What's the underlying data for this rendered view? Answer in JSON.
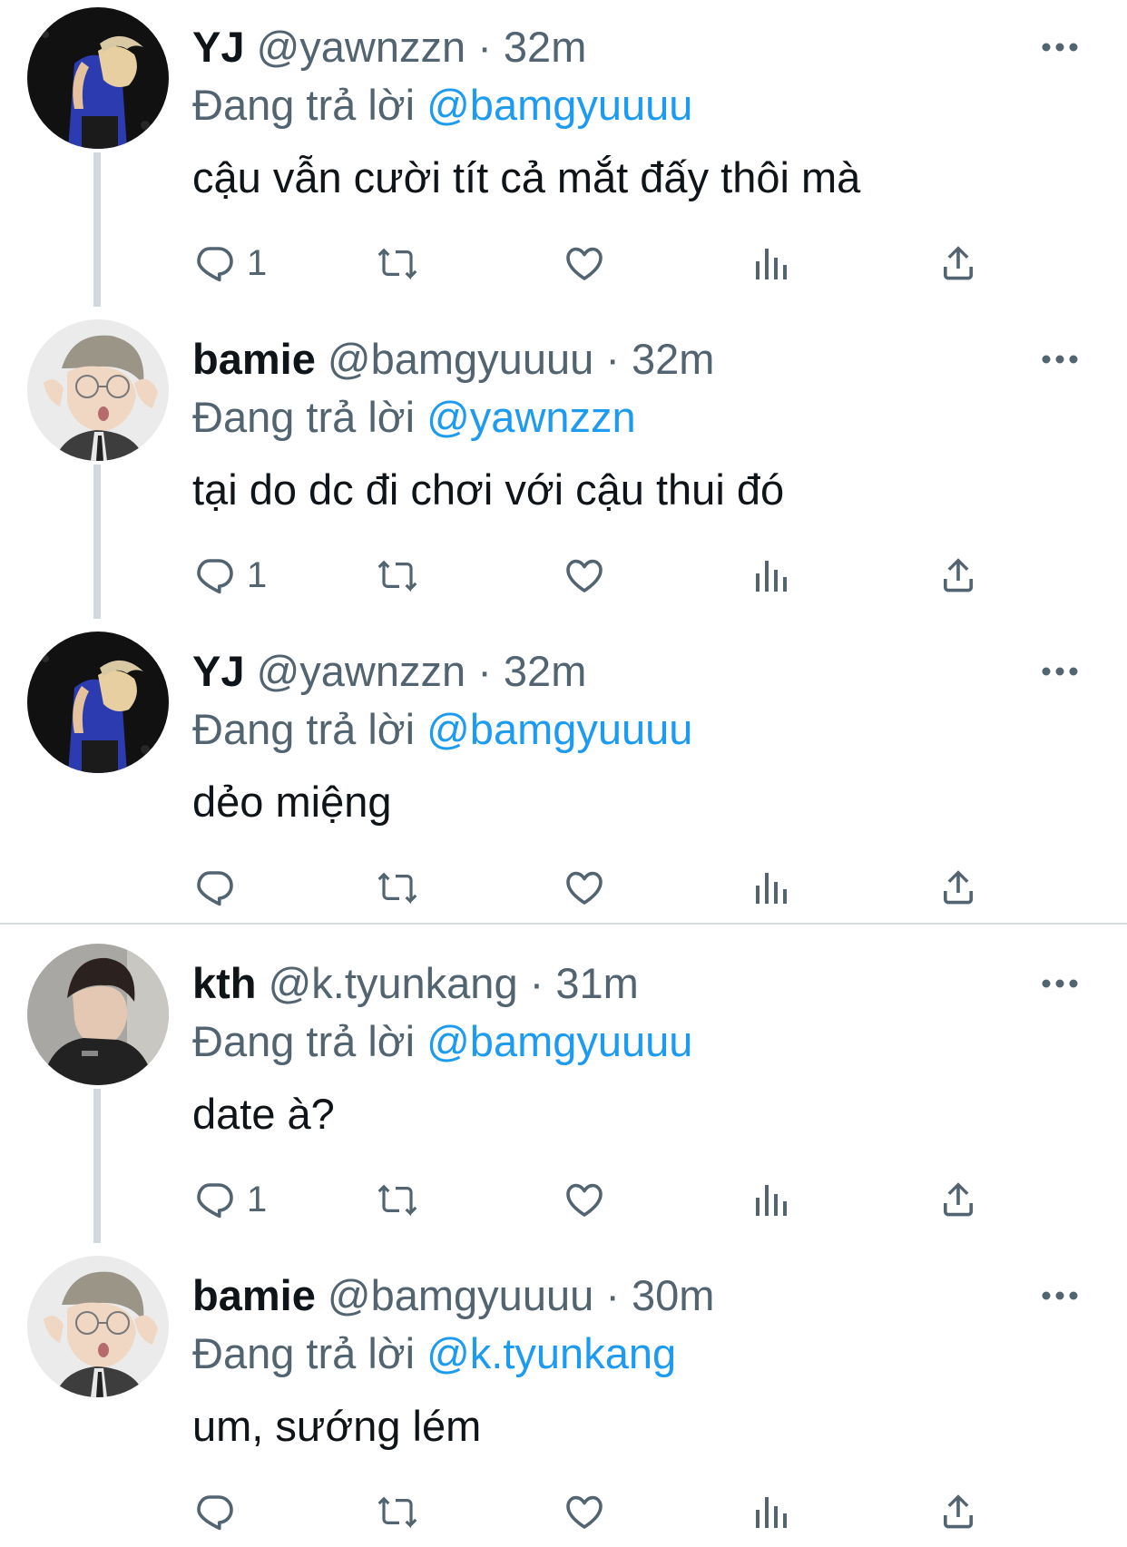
{
  "labels": {
    "replying_prefix": "Đang trả lời"
  },
  "colors": {
    "name": "#0f1419",
    "secondary": "#536471",
    "mention": "#1d9bf0",
    "thread_line": "#cfd9de"
  },
  "tweets": [
    {
      "name": "YJ",
      "handle": "@yawnzzn",
      "separator": "·",
      "time": "32m",
      "replying_to": "@bamgyuuuu",
      "text": "cậu vẫn cười tít cả mắt đấy thôi mà",
      "reply_count": "1",
      "icons": [
        "comment-icon",
        "retweet-icon",
        "heart-icon",
        "analytics-icon",
        "share-icon"
      ]
    },
    {
      "name": "bamie",
      "handle": "@bamgyuuuu",
      "separator": "·",
      "time": "32m",
      "replying_to": "@yawnzzn",
      "text": "tại do dc đi chơi với cậu thui đó",
      "reply_count": "1"
    },
    {
      "name": "YJ",
      "handle": "@yawnzzn",
      "separator": "·",
      "time": "32m",
      "replying_to": "@bamgyuuuu",
      "text": "dẻo miệng",
      "reply_count": ""
    },
    {
      "name": "kth",
      "handle": "@k.tyunkang",
      "separator": "·",
      "time": "31m",
      "replying_to": "@bamgyuuuu",
      "text": "date à?",
      "reply_count": "1"
    },
    {
      "name": "bamie",
      "handle": "@bamgyuuuu",
      "separator": "·",
      "time": "30m",
      "replying_to": "@k.tyunkang",
      "text": "um, sướng lém",
      "reply_count": ""
    }
  ]
}
